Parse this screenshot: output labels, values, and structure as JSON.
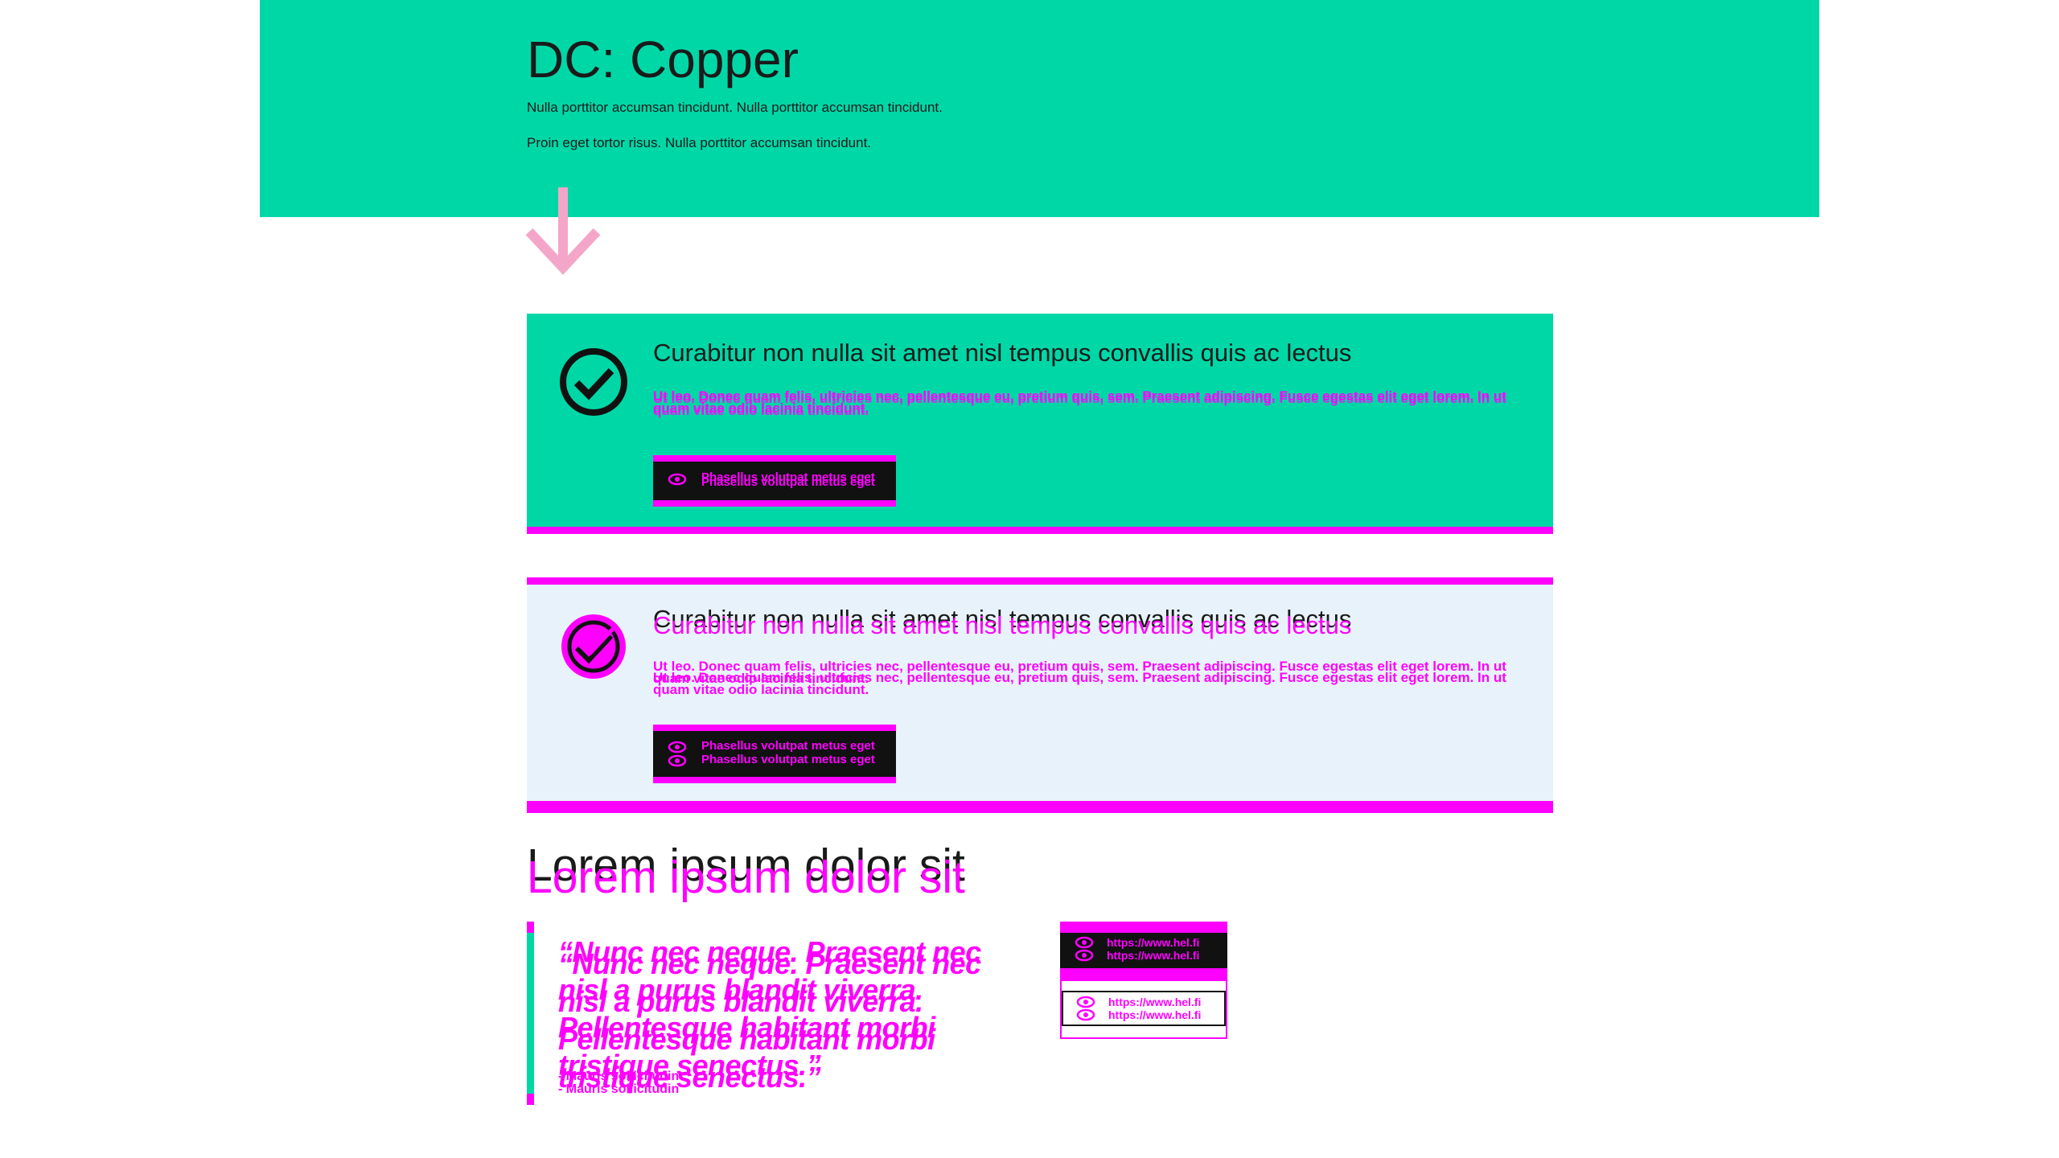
{
  "hero": {
    "title": "DC: Copper",
    "paragraphs": [
      "Nulla porttitor accumsan tincidunt. Nulla porttitor accumsan tincidunt.",
      "Proin eget tortor risus. Nulla porttitor accumsan tincidunt."
    ]
  },
  "notifications": [
    {
      "heading": "Curabitur non nulla sit amet nisl tempus convallis quis ac lectus",
      "body": "Ut leo. Donec quam felis, ultricies nec, pellentesque eu, pretium quis, sem. Praesent adipiscing. Fusce egestas elit eget lorem. In ut quam vitae odio lacinia tincidunt.",
      "button_label": "Phasellus volutpat metus eget"
    },
    {
      "heading": "Curabitur non nulla sit amet nisl tempus convallis quis ac lectus",
      "body": "Ut leo. Donec quam felis, ultricies nec, pellentesque eu, pretium quis, sem. Praesent adipiscing. Fusce egestas elit eget lorem. In ut quam vitae odio lacinia tincidunt.",
      "button_label": "Phasellus volutpat metus eget"
    }
  ],
  "section": {
    "title": "Lorem ipsum dolor sit",
    "quote": "“Nunc nec neque. Praesent nec nisl a purus blandit viverra. Pellentesque habitant morbi tristique senectus.”",
    "cite": "- Mauris sollicitudin",
    "links": [
      "https://www.hel.fi",
      "https://www.hel.fi"
    ]
  },
  "colors": {
    "accent": "#00d7a7",
    "magenta": "#ff00ff",
    "panel_light": "#e8f2fa",
    "arrow": "#f4a6c8"
  },
  "icons": [
    "check-circle-icon",
    "eye-icon",
    "arrow-down-icon"
  ]
}
